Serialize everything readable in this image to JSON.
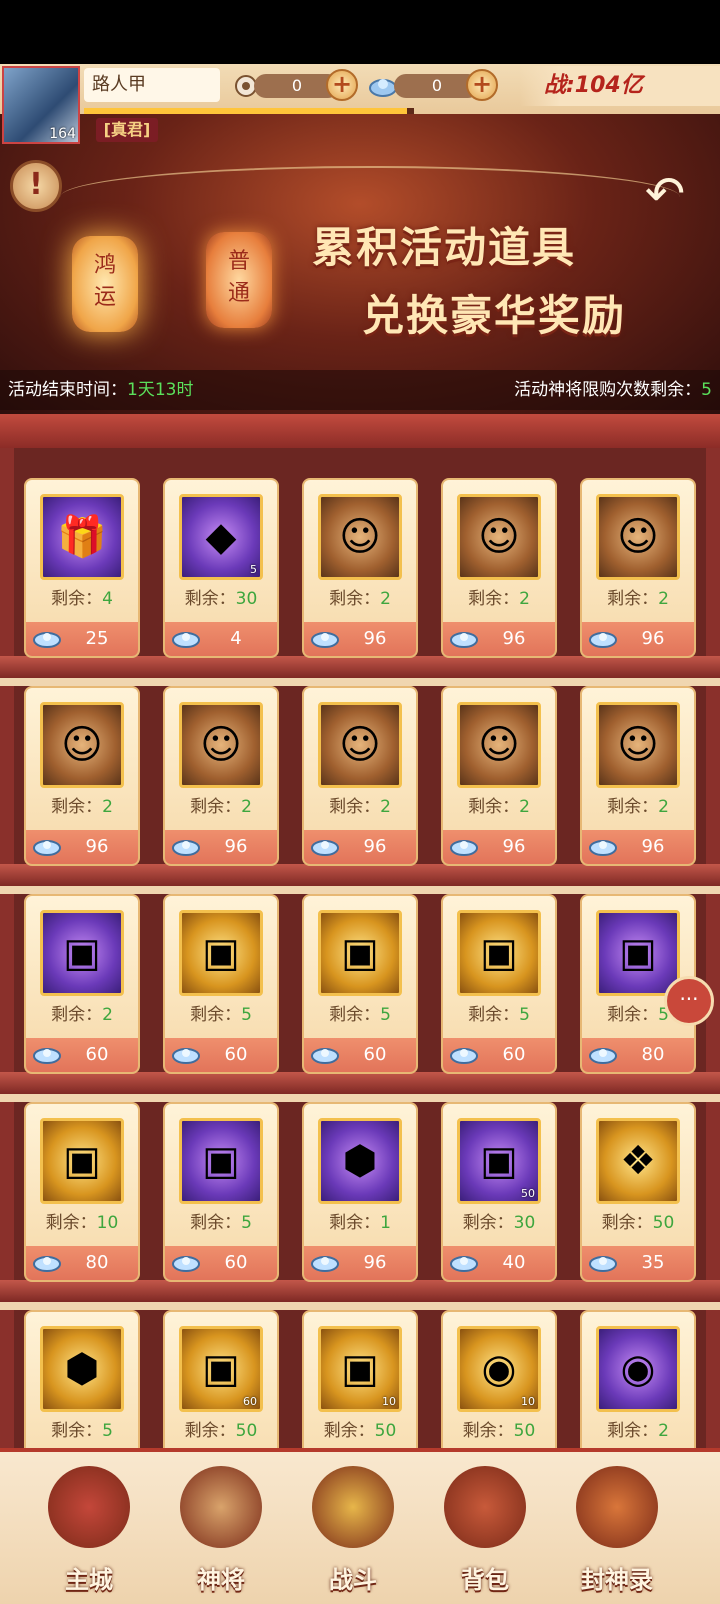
{
  "player": {
    "name": "路人甲",
    "level": "164",
    "title": "[真君]",
    "power": "战:104亿",
    "xp_fraction": 0.98
  },
  "currencies": [
    {
      "icon": "coin-icon",
      "value": "0"
    },
    {
      "icon": "cloud-token-icon",
      "value": "0"
    }
  ],
  "banner": {
    "lanterns": [
      "鸿运",
      "普通"
    ],
    "slogan_line1": "累积活动道具",
    "slogan_line2": "兑换豪华奖励",
    "end_time_label": "活动结束时间：",
    "end_time_value": "1天13时",
    "limit_label": "活动神将限购次数剩余：",
    "limit_value": "5"
  },
  "colors": {
    "accent": "#e2745a",
    "remaining_green": "#3ea63e",
    "shelf": "#6b2622"
  },
  "shop": {
    "remaining_label": "剩余：",
    "items": [
      {
        "art": "purple",
        "icon": "bundle-icon",
        "remaining": "4",
        "price": "25"
      },
      {
        "art": "purple",
        "icon": "mask-icon",
        "qty": "5",
        "remaining": "30",
        "price": "4"
      },
      {
        "art": "hero",
        "icon": "hero-portrait-icon",
        "remaining": "2",
        "price": "96"
      },
      {
        "art": "hero",
        "icon": "hero-portrait-icon",
        "remaining": "2",
        "price": "96"
      },
      {
        "art": "hero",
        "icon": "hero-portrait-icon",
        "remaining": "2",
        "price": "96"
      },
      {
        "art": "hero",
        "icon": "hero-portrait-icon",
        "remaining": "2",
        "price": "96"
      },
      {
        "art": "hero",
        "icon": "hero-portrait-icon",
        "remaining": "2",
        "price": "96"
      },
      {
        "art": "hero",
        "icon": "hero-portrait-icon",
        "remaining": "2",
        "price": "96"
      },
      {
        "art": "hero",
        "icon": "hero-portrait-icon",
        "remaining": "2",
        "price": "96"
      },
      {
        "art": "hero",
        "icon": "hero-portrait-icon",
        "remaining": "2",
        "price": "96"
      },
      {
        "art": "purple",
        "icon": "chest-icon",
        "remaining": "2",
        "price": "60"
      },
      {
        "art": "gold",
        "icon": "chest-icon",
        "remaining": "5",
        "price": "60"
      },
      {
        "art": "gold",
        "icon": "chest-icon",
        "remaining": "5",
        "price": "60"
      },
      {
        "art": "gold",
        "icon": "chest-icon",
        "remaining": "5",
        "price": "60"
      },
      {
        "art": "purple",
        "icon": "chest-icon",
        "remaining": "5",
        "price": "80"
      },
      {
        "art": "gold",
        "icon": "chest-icon",
        "remaining": "10",
        "price": "80"
      },
      {
        "art": "purple",
        "icon": "chest-icon",
        "remaining": "5",
        "price": "60"
      },
      {
        "art": "purple",
        "icon": "gem-icon",
        "remaining": "1",
        "price": "96"
      },
      {
        "art": "purple",
        "icon": "chest-icon",
        "qty": "50",
        "remaining": "30",
        "price": "40"
      },
      {
        "art": "gold",
        "icon": "gift-icon",
        "remaining": "50",
        "price": "35"
      },
      {
        "art": "gold",
        "icon": "gem-icon",
        "remaining": "5",
        "price": ""
      },
      {
        "art": "gold",
        "icon": "chest-icon",
        "qty": "60",
        "remaining": "50",
        "price": ""
      },
      {
        "art": "gold",
        "icon": "chest-icon",
        "qty": "10",
        "remaining": "50",
        "price": ""
      },
      {
        "art": "gold",
        "icon": "orb-icon",
        "qty": "10",
        "remaining": "50",
        "price": ""
      },
      {
        "art": "purple",
        "icon": "orb-icon",
        "remaining": "2",
        "price": ""
      }
    ]
  },
  "nav": [
    {
      "label": "主城",
      "icon": "city-gate-icon"
    },
    {
      "label": "神将",
      "icon": "hero-icon"
    },
    {
      "label": "战斗",
      "icon": "crossed-swords-icon"
    },
    {
      "label": "背包",
      "icon": "bag-icon"
    },
    {
      "label": "封神录",
      "icon": "scroll-icon"
    }
  ]
}
